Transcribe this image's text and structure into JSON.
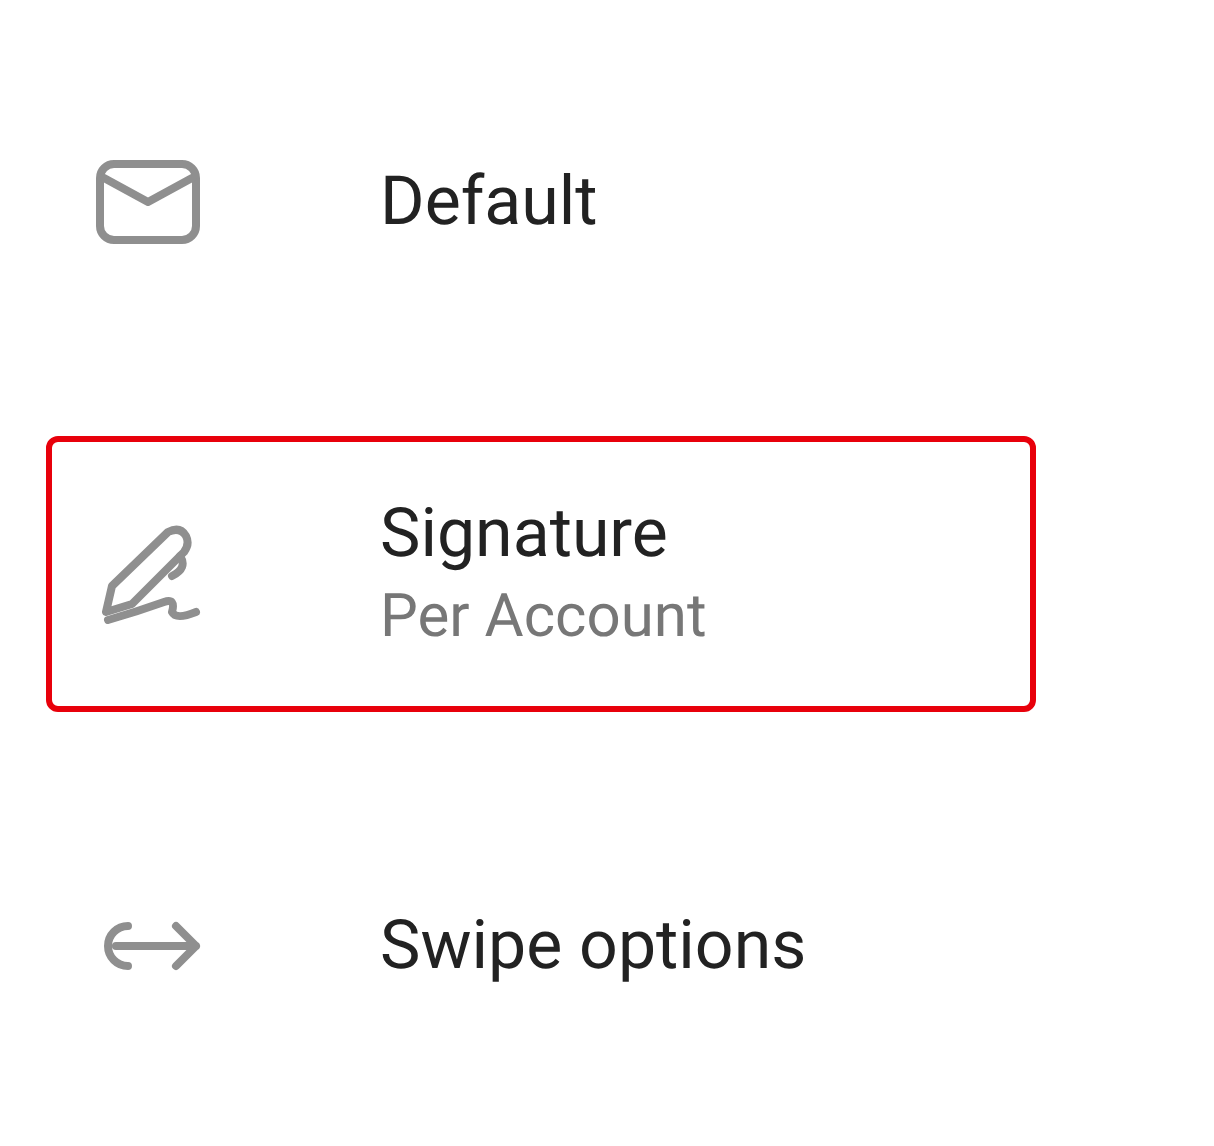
{
  "settings": [
    {
      "kind": "mail",
      "title": "Default",
      "highlighted": false
    },
    {
      "kind": "signature",
      "title": "Signature",
      "subtitle": "Per Account",
      "highlighted": true
    },
    {
      "kind": "swipe",
      "title": "Swipe options",
      "highlighted": false
    }
  ]
}
